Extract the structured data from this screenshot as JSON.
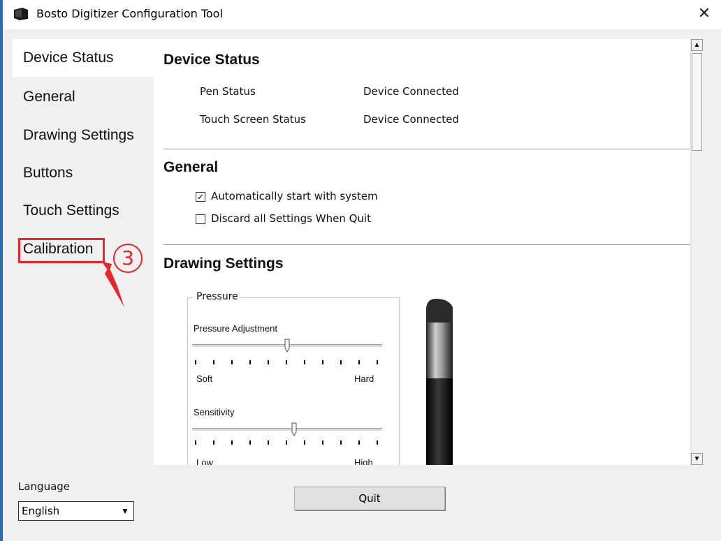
{
  "window": {
    "title": "Bosto Digitizer Configuration Tool",
    "close_glyph": "✕",
    "icon": "tablet-app-icon"
  },
  "sidebar": {
    "items": [
      {
        "label": "Device Status",
        "active": true
      },
      {
        "label": "General",
        "active": false
      },
      {
        "label": "Drawing Settings",
        "active": false
      },
      {
        "label": "Buttons",
        "active": false
      },
      {
        "label": "Touch Settings",
        "active": false
      },
      {
        "label": "Calibration",
        "active": false
      }
    ]
  },
  "annotation": {
    "callout_number": "3",
    "color": "#e8262b"
  },
  "device_status": {
    "title": "Device Status",
    "rows": [
      {
        "name": "Pen Status",
        "value": "Device Connected"
      },
      {
        "name": "Touch Screen Status",
        "value": "Device Connected"
      }
    ]
  },
  "general": {
    "title": "General",
    "options": [
      {
        "label": "Automatically start with system",
        "checked": true
      },
      {
        "label": "Discard all Settings When Quit",
        "checked": false
      }
    ]
  },
  "drawing_settings": {
    "title": "Drawing Settings",
    "pressure_group": {
      "legend": "Pressure",
      "pressure_adjustment": {
        "label": "Pressure Adjustment",
        "min_label": "Soft",
        "max_label": "Hard",
        "level": 0.5
      },
      "sensitivity": {
        "label": "Sensitivity",
        "min_label": "Low",
        "max_label": "High",
        "level": 0.55
      }
    }
  },
  "footer": {
    "language_label": "Language",
    "language_value": "English",
    "quit_label": "Quit"
  }
}
